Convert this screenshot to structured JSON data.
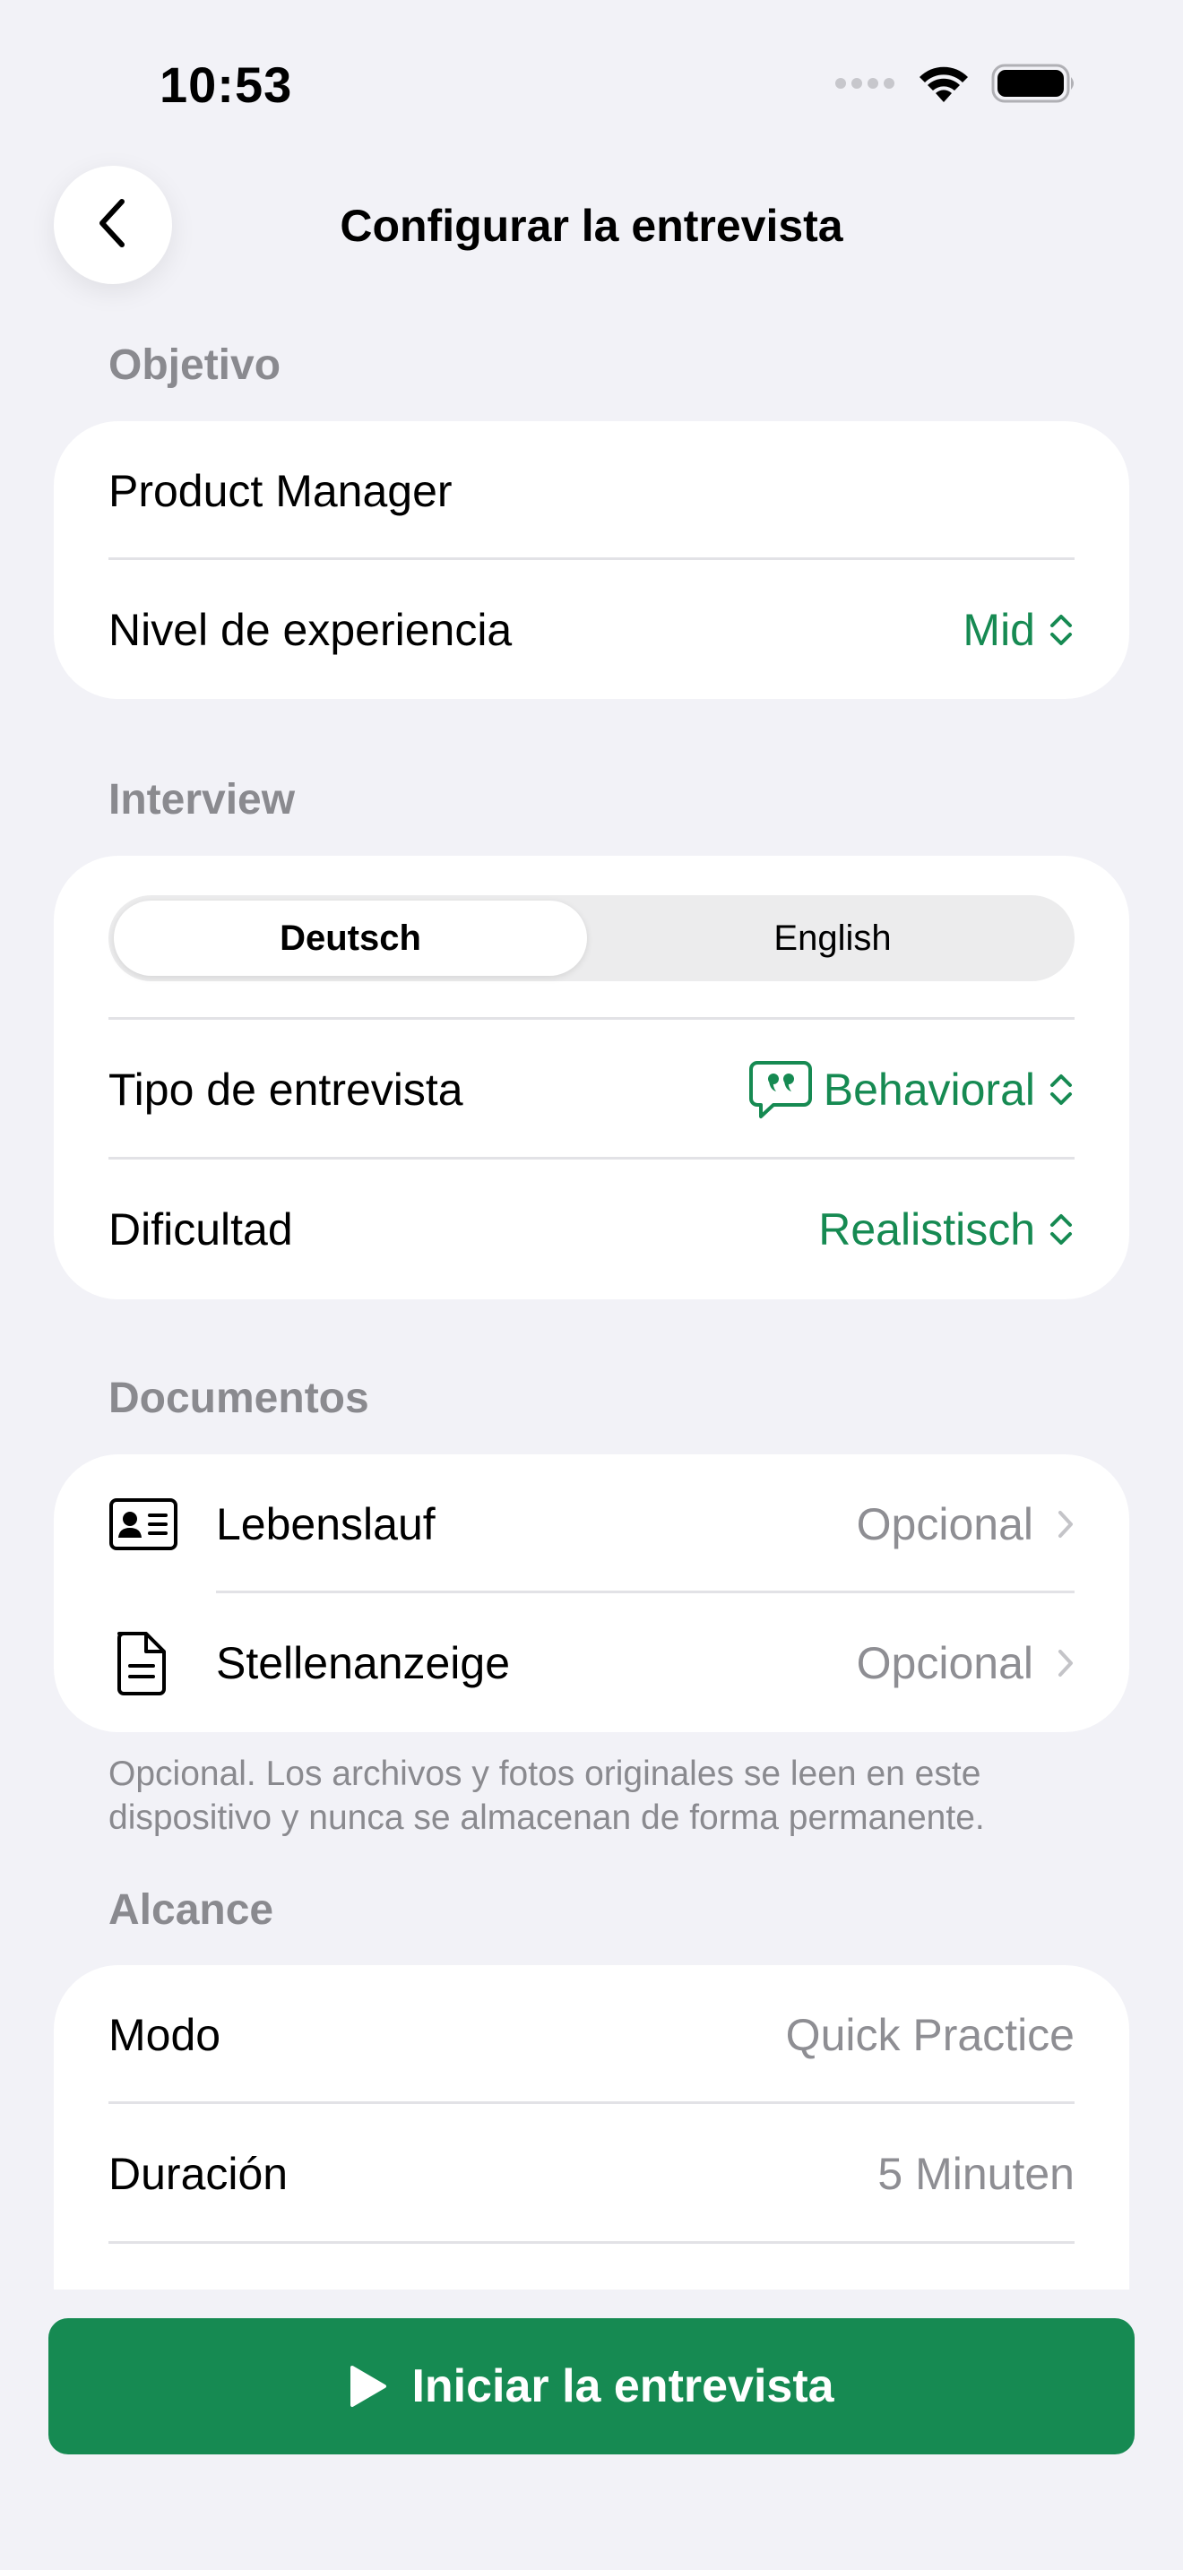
{
  "status_bar": {
    "time": "10:53"
  },
  "nav": {
    "title": "Configurar la entrevista",
    "back_icon": "chevron-left-icon"
  },
  "colors": {
    "accent": "#168a52",
    "background": "#f2f2f7",
    "card": "#ffffff",
    "secondary_text": "#8e8e93"
  },
  "objective": {
    "header": "Objetivo",
    "role": "Product Manager",
    "experience_label": "Nivel de experiencia",
    "experience_value": "Mid"
  },
  "interview": {
    "header": "Interview",
    "languages": [
      "Deutsch",
      "English"
    ],
    "selected_language": "Deutsch",
    "type_label": "Tipo de entrevista",
    "type_icon": "quote-bubble-icon",
    "type_value": "Behavioral",
    "difficulty_label": "Dificultad",
    "difficulty_value": "Realistisch"
  },
  "documents": {
    "header": "Documentos",
    "items": [
      {
        "icon": "id-card-icon",
        "label": "Lebenslauf",
        "value": "Opcional"
      },
      {
        "icon": "document-icon",
        "label": "Stellenanzeige",
        "value": "Opcional"
      }
    ],
    "footnote": "Opcional. Los archivos y fotos originales se leen en este dispositivo y nunca se almacenan de forma permanente."
  },
  "scope": {
    "header": "Alcance",
    "mode_label": "Modo",
    "mode_value": "Quick Practice",
    "duration_label": "Duración",
    "duration_value": "5 Minuten"
  },
  "footer": {
    "start_label": "Iniciar la entrevista",
    "start_icon": "play-icon"
  }
}
